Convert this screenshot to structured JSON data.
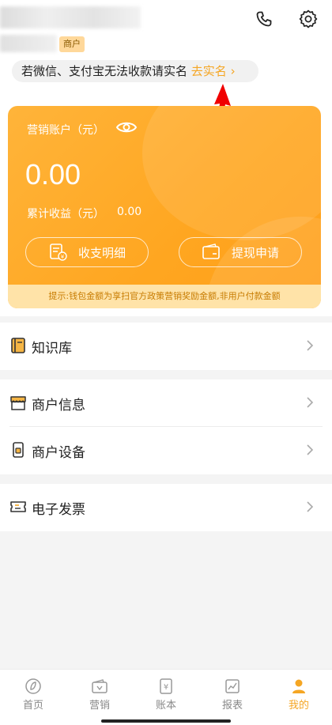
{
  "header": {
    "merchant_badge": "商户",
    "phone_icon": "phone-icon",
    "settings_icon": "gear-icon"
  },
  "notice": {
    "text": "若微信、支付宝无法收款请实名",
    "link": "去实名",
    "chevron": "›"
  },
  "card": {
    "account_label": "营销账户（元）",
    "balance": "0.00",
    "cumulative_label": "累计收益（元）",
    "cumulative_value": "0.00",
    "btn_details": "收支明细",
    "btn_withdraw": "提现申请",
    "tip": "提示:钱包金额为享扫官方政策营销奖励金额,非用户付款金额"
  },
  "menu": {
    "knowledge": "知识库",
    "merchant_info": "商户信息",
    "merchant_device": "商户设备",
    "invoice": "电子发票"
  },
  "tabs": [
    "首页",
    "营销",
    "账本",
    "报表",
    "我的"
  ],
  "colors": {
    "accent": "#f5a623",
    "card": "#ffa620",
    "tip_bg": "#ffe3a8"
  }
}
